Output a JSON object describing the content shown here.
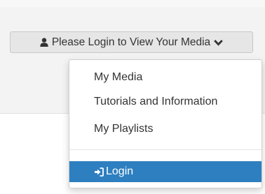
{
  "header": {
    "login_prompt": "Please Login to View Your Media",
    "user_icon": "user-icon",
    "caret_icon": "chevron-down-icon"
  },
  "menu": {
    "items": [
      {
        "label": "My Media"
      },
      {
        "label": "Tutorials and Information"
      },
      {
        "label": "My Playlists"
      }
    ],
    "login": {
      "label": "Login",
      "icon": "sign-in-icon"
    }
  },
  "colors": {
    "accent": "#2d7fc0",
    "button_bg": "#e6e6e6",
    "text": "#333333"
  }
}
